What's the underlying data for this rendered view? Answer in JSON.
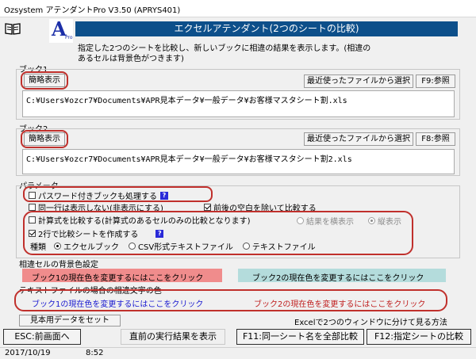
{
  "window": {
    "title": "Ozsystem アテンダントPro V3.50 (APRYS401)"
  },
  "header": {
    "logo_letter": "A",
    "logo_sub": "Pro",
    "banner": "エクセルアテンダント(2つのシートの比較)",
    "description_line1": "指定した2つのシートを比較し、新しいブックに相違の結果を表示します。(相違の",
    "description_line2": "あるセルは背景色がつきます)"
  },
  "book1": {
    "label": "ブック1",
    "summary_button": "簡略表示",
    "recent_button": "最近使ったファイルから選択",
    "browse_button": "F9:参照",
    "path": "C:¥Users¥ozcr7¥Documents¥APR見本データ¥一般データ¥お客様マスタシート割.xls"
  },
  "book2": {
    "label": "ブック2",
    "summary_button": "簡略表示",
    "recent_button": "最近使ったファイルから選択",
    "browse_button": "F8:参照",
    "path": "C:¥Users¥ozcr7¥Documents¥APR見本データ¥一般データ¥お客様マスタシート割2.xls"
  },
  "params": {
    "label": "パラメータ",
    "password": "パスワード付きブックも処理する",
    "same_row": "同一行は表示しない(非表示にする)",
    "trim_spaces": "前後の空白を除いて比較する",
    "formula": "計算式を比較する(計算式のあるセルのみの比較となります)",
    "side_by_side": "結果を横表示",
    "vertical": "縦表示",
    "two_rows": "2行で比較シートを作成する",
    "kind_label": "種類",
    "excel_book": "エクセルブック",
    "csv": "CSV形式テキストファイル",
    "text_file": "テキストファイル",
    "help": "?"
  },
  "bgcolor": {
    "label": "相違セルの背景色設定",
    "book1_text": "ブック1の現在色を変更するにはここをクリック",
    "book2_text": "ブック2の現在色を変更するにはここをクリック",
    "book1_color": "#f08c8c",
    "book2_color": "#b4dcdc"
  },
  "textcolor": {
    "label": "テキストファイルの場合の相違文字の色",
    "book1_text": "ブック1の現在色を変更するにはここをクリック",
    "book2_text": "ブック2の現在色を変更するにはここをクリック",
    "book1_color": "#1a1ad0",
    "book2_color": "#c02020"
  },
  "bottom": {
    "sample_button": "見本用データをセット",
    "split_text": "Excelで2つのウィンドウに分けて見る方法",
    "esc_button": "ESC:前画面へ",
    "prev_result_button": "直前の実行結果を表示",
    "f11_button": "F11:同一シート名を全部比較",
    "f12_button": "F12:指定シートの比較"
  },
  "status": {
    "date": "2017/10/19",
    "time": "8:52"
  }
}
